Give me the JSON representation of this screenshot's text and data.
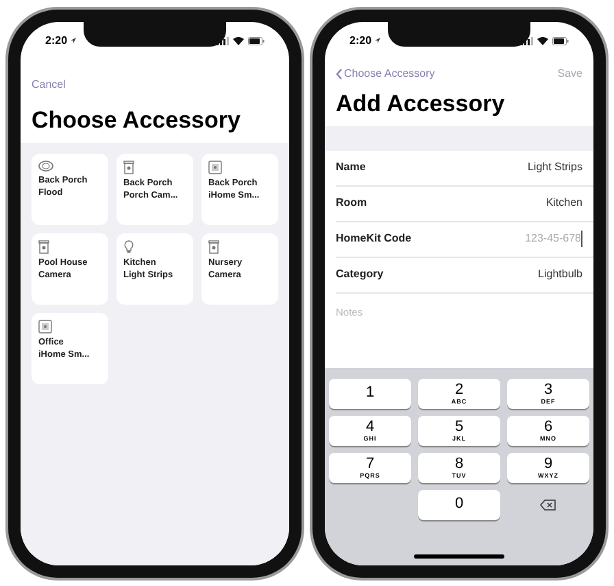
{
  "phones": [
    {
      "kind": "chooser",
      "status": {
        "time": "2:20"
      },
      "nav": {
        "back": "Cancel"
      },
      "title": "Choose Accessory",
      "accessories": [
        {
          "kind": "flood",
          "room": "Back Porch",
          "name": "Flood"
        },
        {
          "kind": "camera",
          "room": "Back Porch",
          "name": "Porch Cam..."
        },
        {
          "kind": "smart",
          "room": "Back Porch",
          "name": "iHome Sm..."
        },
        {
          "kind": "camera",
          "room": "Pool House",
          "name": "Camera"
        },
        {
          "kind": "bulb",
          "room": "Kitchen",
          "name": "Light Strips"
        },
        {
          "kind": "camera",
          "room": "Nursery",
          "name": "Camera"
        },
        {
          "kind": "smart",
          "room": "Office",
          "name": "iHome Sm..."
        }
      ]
    },
    {
      "kind": "form",
      "status": {
        "time": "2:20"
      },
      "nav": {
        "back": "Choose Accessory",
        "save": {
          "label": "Save",
          "disabled": true
        }
      },
      "title": "Add Accessory",
      "fields": [
        {
          "kind": "value",
          "label": "Name",
          "value": "Light Strips"
        },
        {
          "kind": "value",
          "label": "Room",
          "value": "Kitchen"
        },
        {
          "kind": "input",
          "label": "HomeKit Code",
          "placeholder": "123-45-678"
        },
        {
          "kind": "value",
          "label": "Category",
          "value": "Lightbulb"
        },
        {
          "kind": "notes",
          "placeholder": "Notes"
        }
      ],
      "keypad": [
        {
          "kind": "digit",
          "digit": "1"
        },
        {
          "kind": "digit",
          "digit": "2",
          "letters": "ABC"
        },
        {
          "kind": "digit",
          "digit": "3",
          "letters": "DEF"
        },
        {
          "kind": "digit",
          "digit": "4",
          "letters": "GHI"
        },
        {
          "kind": "digit",
          "digit": "5",
          "letters": "JKL"
        },
        {
          "kind": "digit",
          "digit": "6",
          "letters": "MNO"
        },
        {
          "kind": "digit",
          "digit": "7",
          "letters": "PQRS"
        },
        {
          "kind": "digit",
          "digit": "8",
          "letters": "TUV"
        },
        {
          "kind": "digit",
          "digit": "9",
          "letters": "WXYZ"
        },
        {
          "kind": "blank"
        },
        {
          "kind": "digit",
          "digit": "0"
        },
        {
          "kind": "delete"
        }
      ]
    }
  ]
}
